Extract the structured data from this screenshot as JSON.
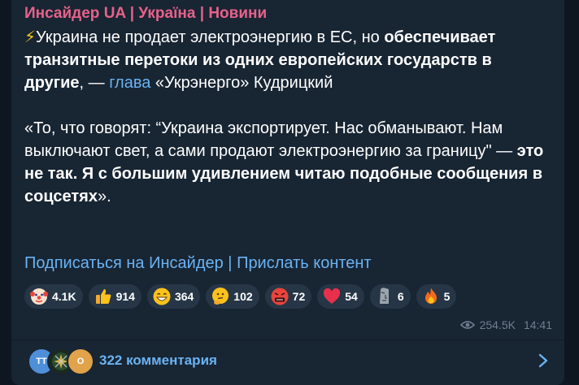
{
  "post": {
    "channel_name": "Инсайдер UA | Україна | Новини",
    "p1_lightning": "⚡",
    "p1_a": "Украина не продает электроэнергию в ЕС, но ",
    "p1_b_bold": "обеспечивает транзитные перетоки из одних европейских государств в другие",
    "p1_c": ", — ",
    "p1_link": "глава",
    "p1_d": " «Укрэнерго» Кудрицкий",
    "p2_a": "«То, что говорят: “Украина экспортирует. Нас обманывают. Нам выключают свет, а сами продают электроэнергию за границу\" — ",
    "p2_b_bold": "это не так. Я с большим удивлением читаю подобные сообщения в соцсетях",
    "p2_c": "».",
    "footer_link_1": "Подписаться на Инсайдер",
    "footer_sep": " | ",
    "footer_link_2": "Прислать контент"
  },
  "reactions": [
    {
      "icon": "clown-face-icon",
      "count": "4.1K"
    },
    {
      "icon": "thumbs-up-icon",
      "count": "914"
    },
    {
      "icon": "grinning-face-icon",
      "count": "364"
    },
    {
      "icon": "thinking-face-icon",
      "count": "102"
    },
    {
      "icon": "cursing-face-icon",
      "count": "72"
    },
    {
      "icon": "red-heart-icon",
      "count": "54"
    },
    {
      "icon": "moai-icon",
      "count": "6"
    },
    {
      "icon": "fire-icon",
      "count": "5"
    }
  ],
  "meta": {
    "views": "254.5K",
    "time": "14:41"
  },
  "comments": {
    "avatar_1_initials": "TT",
    "avatar_3_initials": "O",
    "label": "322 комментария"
  },
  "colors": {
    "background": "#0e1621",
    "bubble": "#182533",
    "channel_name": "#e7628a",
    "link": "#6ab3f3",
    "reaction_pill": "#263646",
    "meta_text": "#6d7f8f"
  }
}
